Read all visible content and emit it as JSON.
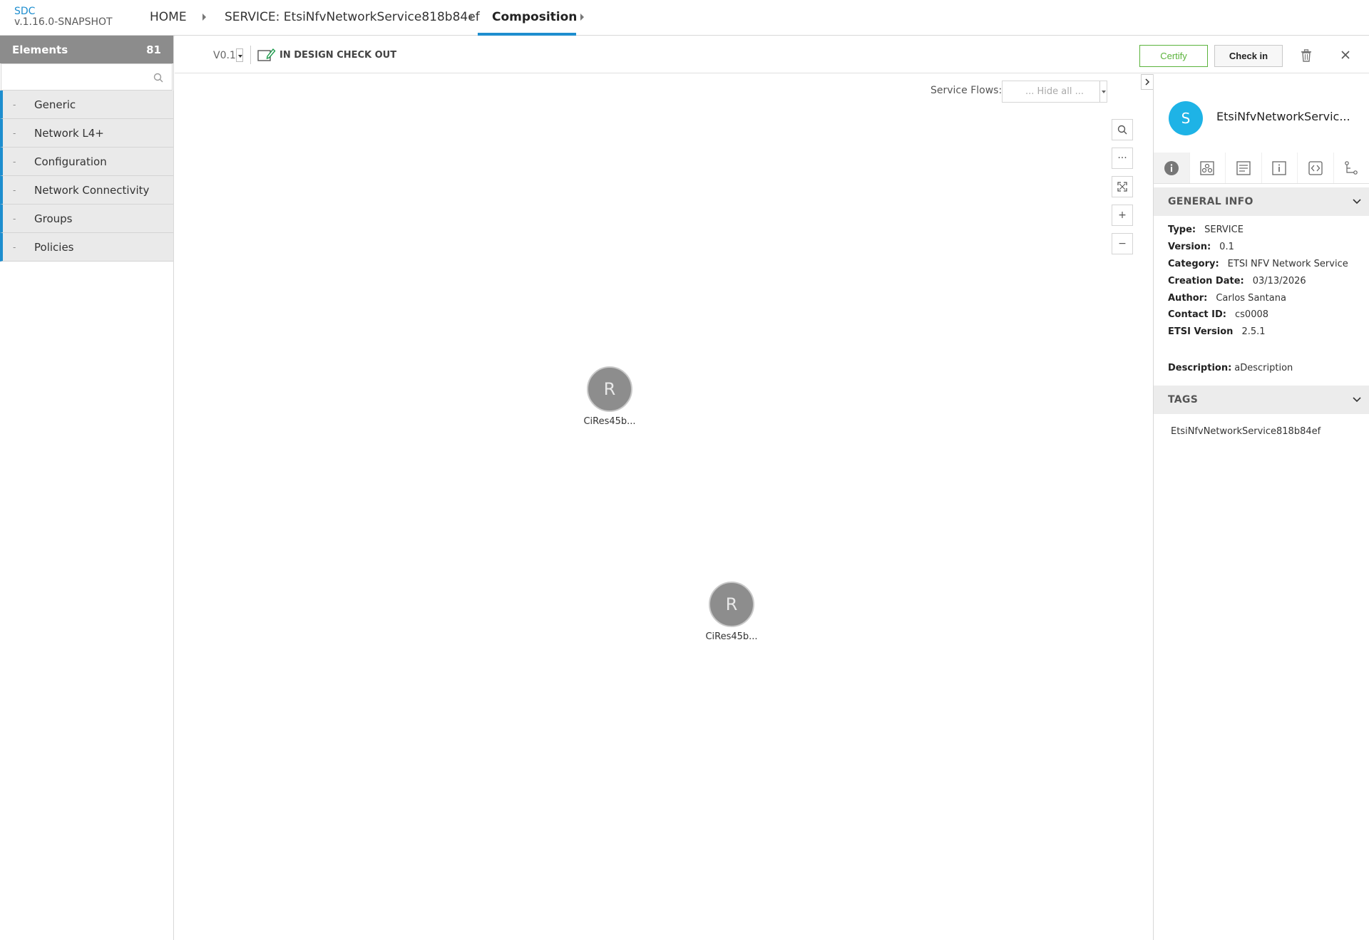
{
  "brand": {
    "logo": "SDC",
    "version": "v.1.16.0-SNAPSHOT"
  },
  "breadcrumbs": [
    {
      "label": "HOME"
    },
    {
      "label": "SERVICE: EtsiNfvNetworkService818b84ef"
    },
    {
      "label": "Composition"
    }
  ],
  "sidebar": {
    "title": "Elements",
    "count": "81",
    "search_placeholder": "",
    "categories": [
      {
        "label": "Generic"
      },
      {
        "label": "Network L4+"
      },
      {
        "label": "Configuration"
      },
      {
        "label": "Network Connectivity"
      },
      {
        "label": "Groups"
      },
      {
        "label": "Policies"
      }
    ]
  },
  "workspace": {
    "version": "V0.1",
    "status": "IN DESIGN CHECK OUT",
    "certify_label": "Certify",
    "checkin_label": "Check in"
  },
  "canvas": {
    "service_flows_label": "Service Flows:",
    "service_flows_value": "... Hide all ...",
    "nodes": [
      {
        "letter": "R",
        "label": "CiRes45b..."
      },
      {
        "letter": "R",
        "label": "CiRes45b..."
      }
    ]
  },
  "panel": {
    "avatar_letter": "S",
    "title": "EtsiNfvNetworkServic...",
    "general_info_title": "GENERAL INFO",
    "fields": [
      {
        "label": "Type:",
        "value": "SERVICE"
      },
      {
        "label": "Version:",
        "value": "0.1"
      },
      {
        "label": "Category:",
        "value": "ETSI NFV Network Service"
      },
      {
        "label": "Creation Date:",
        "value": "03/13/2026"
      },
      {
        "label": "Author:",
        "value": "Carlos Santana"
      },
      {
        "label": "Contact ID:",
        "value": "cs0008"
      },
      {
        "label": "ETSI Version",
        "value": "2.5.1"
      }
    ],
    "description_label": "Description:",
    "description_value": "aDescription",
    "tags_title": "TAGS",
    "tags": [
      "EtsiNfvNetworkService818b84ef"
    ]
  },
  "colors": {
    "accent": "#1e8ecf",
    "certify": "#5bb33c",
    "avatar": "#1eb3e6",
    "node": "#8d8d8d"
  }
}
